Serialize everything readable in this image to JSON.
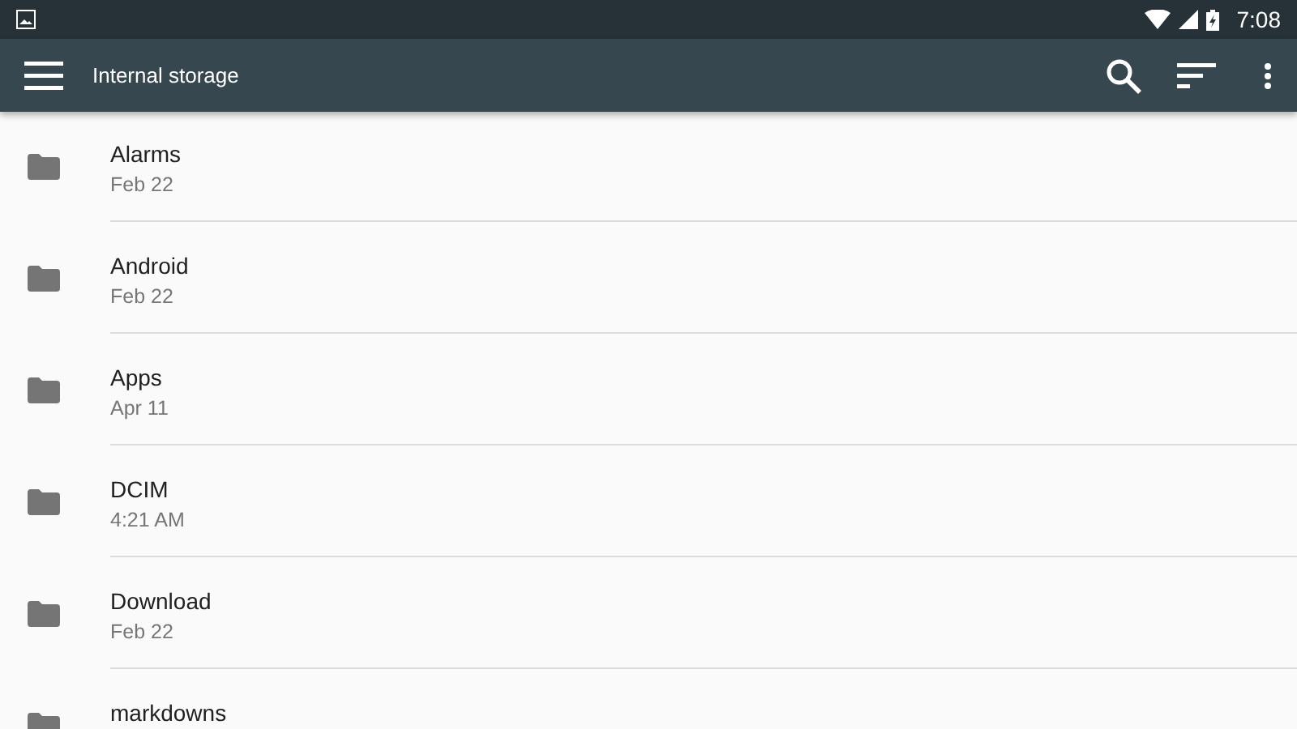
{
  "status_bar": {
    "time": "7:08"
  },
  "toolbar": {
    "title": "Internal storage"
  },
  "files": [
    {
      "name": "Alarms",
      "date": "Feb 22"
    },
    {
      "name": "Android",
      "date": "Feb 22"
    },
    {
      "name": "Apps",
      "date": "Apr 11"
    },
    {
      "name": "DCIM",
      "date": "4:21 AM"
    },
    {
      "name": "Download",
      "date": "Feb 22"
    },
    {
      "name": "markdowns"
    }
  ]
}
